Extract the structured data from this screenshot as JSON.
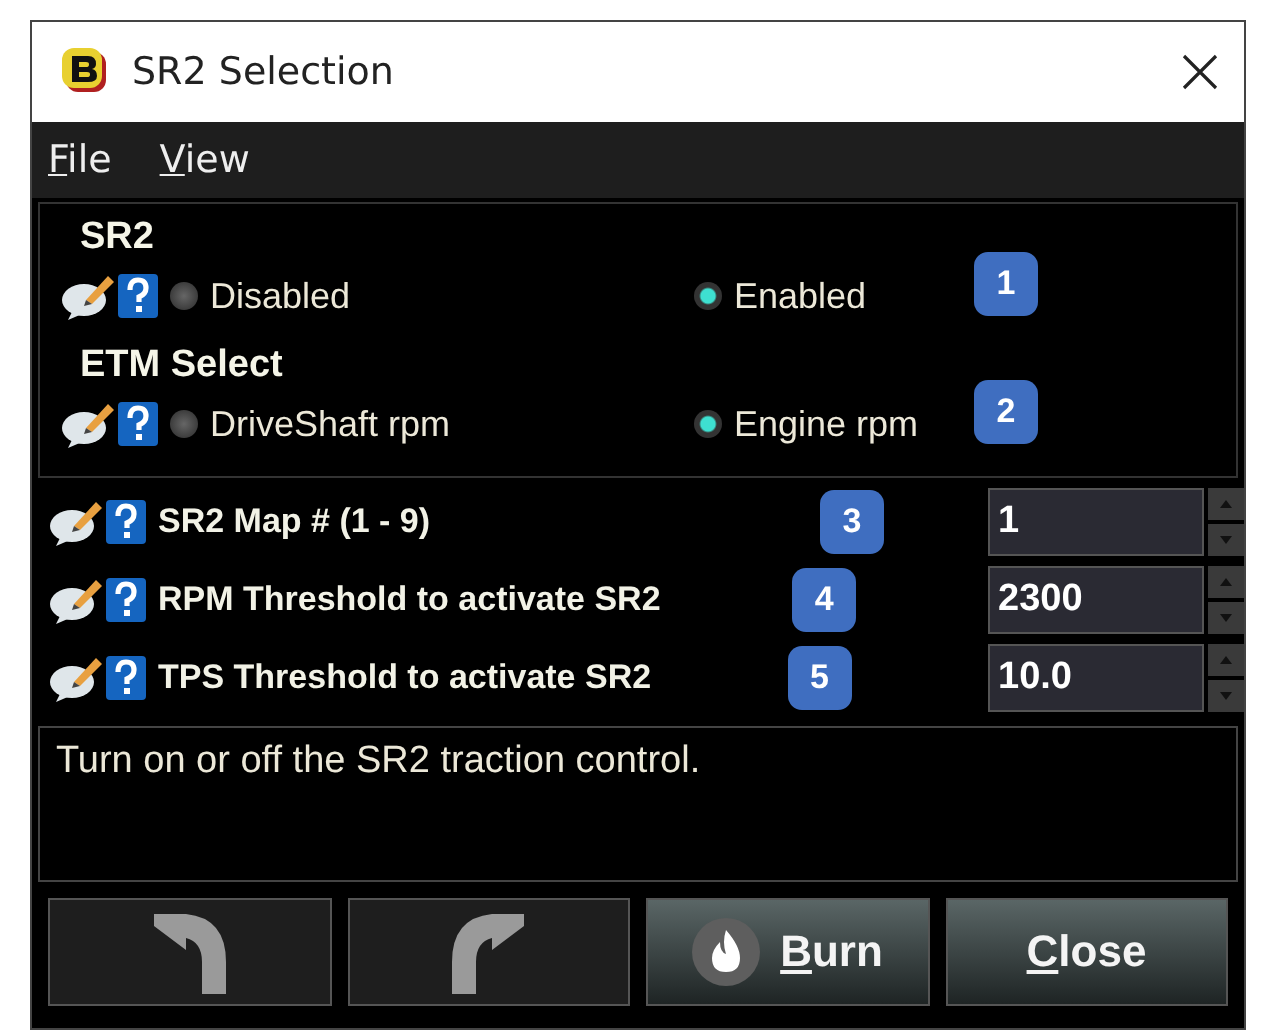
{
  "window": {
    "title": "SR2 Selection"
  },
  "menu": [
    {
      "label": "File",
      "underlined_first_letter": true
    },
    {
      "label": "View",
      "underlined_first_letter": true
    }
  ],
  "radio_groups": [
    {
      "title": "SR2",
      "badge": "1",
      "options": [
        {
          "label": "Disabled",
          "selected": false
        },
        {
          "label": "Enabled",
          "selected": true
        }
      ]
    },
    {
      "title": "ETM Select",
      "badge": "2",
      "options": [
        {
          "label": "DriveShaft rpm",
          "selected": false
        },
        {
          "label": "Engine rpm",
          "selected": true
        }
      ]
    }
  ],
  "fields": [
    {
      "label": "SR2 Map # (1 - 9)",
      "badge": "3",
      "value": "1"
    },
    {
      "label": "RPM Threshold to activate SR2",
      "badge": "4",
      "value": "2300"
    },
    {
      "label": "TPS Threshold to activate SR2",
      "badge": "5",
      "value": "10.0"
    }
  ],
  "description": "Turn on or off the SR2 traction control.",
  "buttons": [
    {
      "kind": "undo",
      "disabled": true
    },
    {
      "kind": "redo",
      "disabled": true
    },
    {
      "kind": "burn",
      "label": "Burn",
      "underlined_first_letter": true,
      "disabled": false
    },
    {
      "kind": "close",
      "label": "Close",
      "underlined_first_letter": true,
      "disabled": false
    }
  ]
}
